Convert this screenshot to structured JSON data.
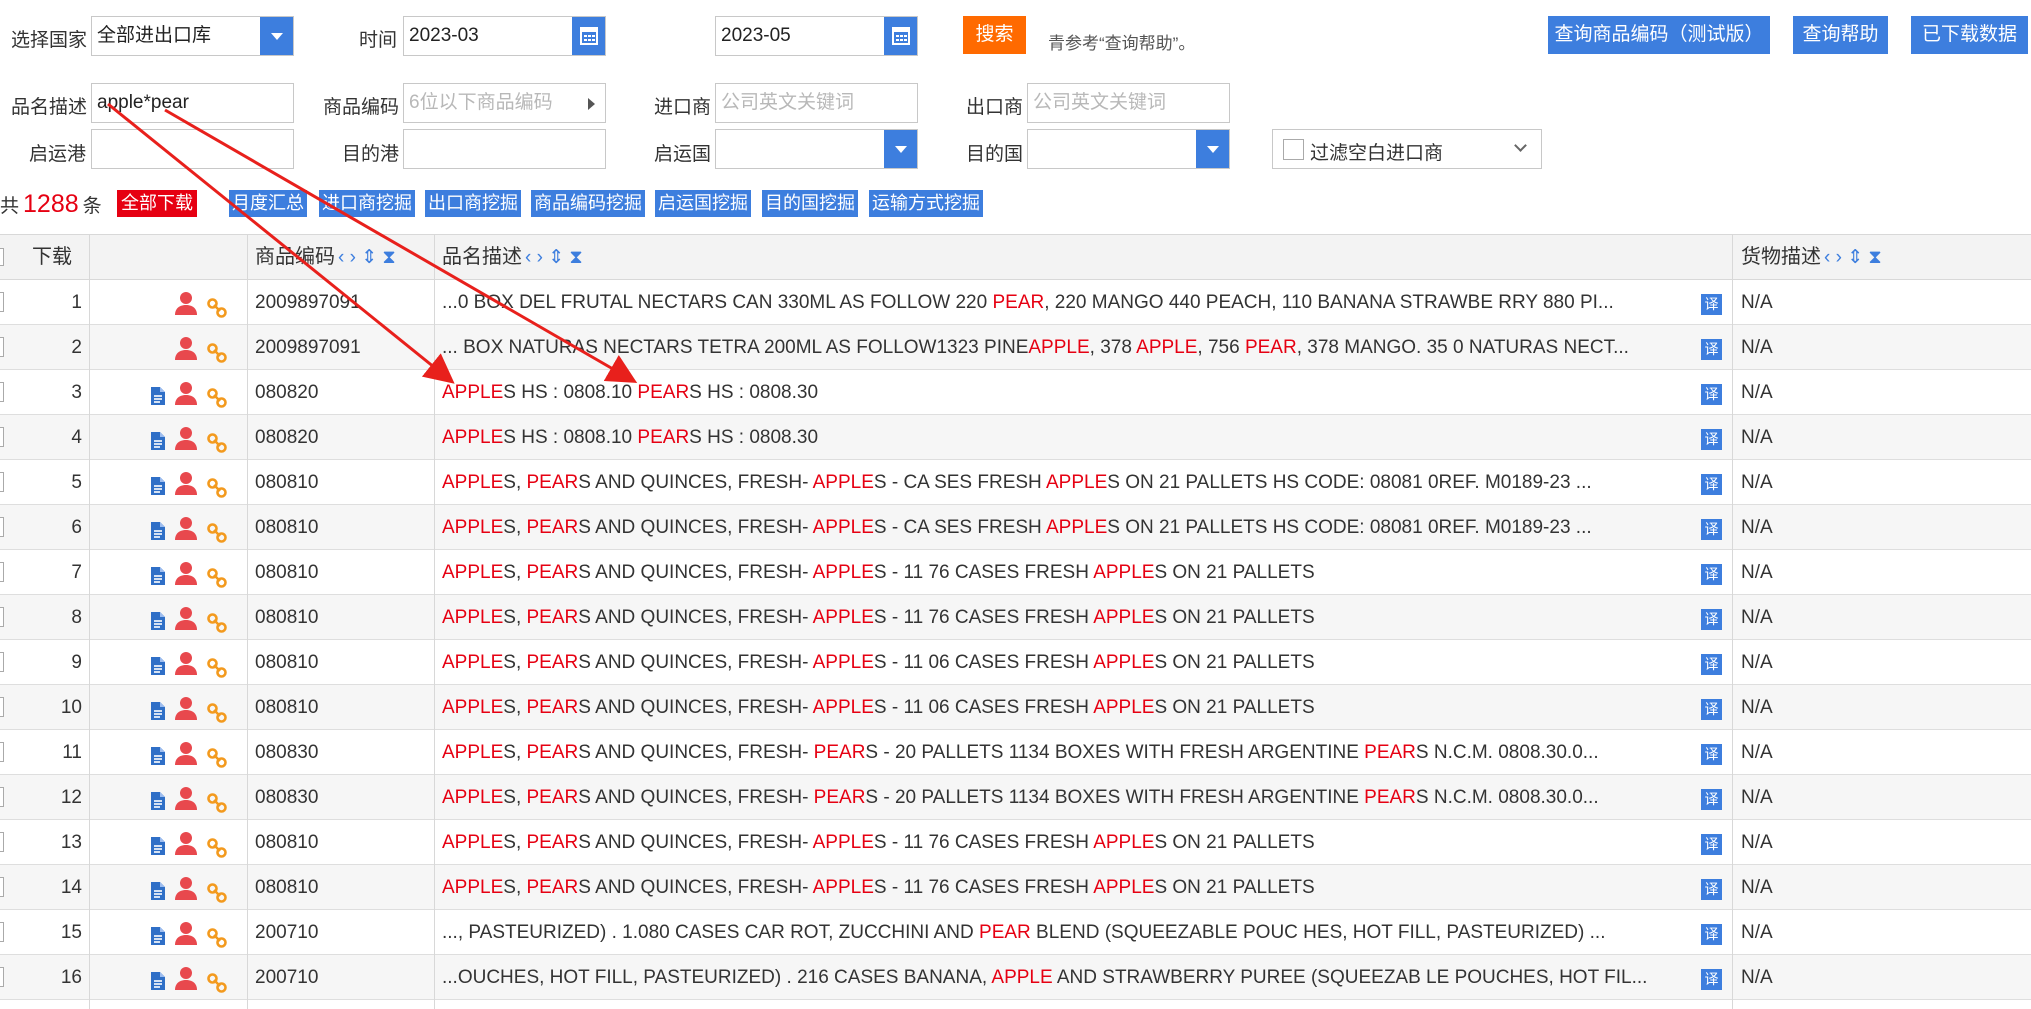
{
  "filters": {
    "country_label": "选择国家",
    "country_value": "全部进出口库",
    "time_label": "时间",
    "time_start": "2023-03",
    "time_end": "2023-05",
    "search_button": "搜索",
    "hint": "青参考“查询帮助”。",
    "product_desc_label": "品名描述",
    "product_desc_value": "apple*pear",
    "product_code_label": "商品编码",
    "product_code_placeholder": "6位以下商品编码",
    "importer_label": "进口商",
    "importer_placeholder": "公司英文关键词",
    "exporter_label": "出口商",
    "exporter_placeholder": "公司英文关键词",
    "origin_port_label": "启运港",
    "dest_port_label": "目的港",
    "origin_country_label": "启运国",
    "dest_country_label": "目的国",
    "filter_blank_importer": "过滤空白进口商"
  },
  "top_buttons": {
    "query_code": "查询商品编码（测试版）",
    "query_help": "查询帮助",
    "downloaded": "已下载数据"
  },
  "summary": {
    "prefix": "共",
    "count": "1288",
    "suffix": "条",
    "download_all": "全部下载"
  },
  "tools": [
    "月度汇总",
    "进口商挖掘",
    "出口商挖掘",
    "商品编码挖掘",
    "启运国挖掘",
    "目的国挖掘",
    "运输方式挖掘"
  ],
  "table": {
    "headers": {
      "download": "下载",
      "code": "商品编码",
      "desc": "品名描述",
      "goods": "货物描述"
    },
    "sort_icons": "‹ › ⇕ ⧗",
    "translate_icon": "译",
    "rows": [
      {
        "idx": "1",
        "doc": false,
        "code": "2009897091",
        "desc": "...0 BOX DEL FRUTAL NECTARS CAN 330ML AS FOLLOW 220 <b>PEAR</b>, 220 MANGO 440 PEACH, 110 BANANA STRAWBE RRY 880 PI...",
        "goods": "N/A"
      },
      {
        "idx": "2",
        "doc": false,
        "code": "2009897091",
        "desc": "... BOX NATURAS NECTARS TETRA 200ML AS FOLLOW1323 PINE<b>APPLE</b>, 378 <b>APPLE</b>, 756 <b>PEAR</b>, 378 MANGO. 35 0 NATURAS NECT...",
        "goods": "N/A"
      },
      {
        "idx": "3",
        "doc": true,
        "code": "080820",
        "desc": "<b>APPLE</b>S HS : 0808.10 <b>PEAR</b>S HS : 0808.30",
        "goods": "N/A"
      },
      {
        "idx": "4",
        "doc": true,
        "code": "080820",
        "desc": "<b>APPLE</b>S HS : 0808.10 <b>PEAR</b>S HS : 0808.30",
        "goods": "N/A"
      },
      {
        "idx": "5",
        "doc": true,
        "code": "080810",
        "desc": "<b>APPLE</b>S, <b>PEAR</b>S AND QUINCES, FRESH- <b>APPLE</b>S - CA SES FRESH <b>APPLE</b>S ON 21 PALLETS HS CODE: 08081 0REF. M0189-23 ...",
        "goods": "N/A"
      },
      {
        "idx": "6",
        "doc": true,
        "code": "080810",
        "desc": "<b>APPLE</b>S, <b>PEAR</b>S AND QUINCES, FRESH- <b>APPLE</b>S - CA SES FRESH <b>APPLE</b>S ON 21 PALLETS HS CODE: 08081 0REF. M0189-23 ...",
        "goods": "N/A"
      },
      {
        "idx": "7",
        "doc": true,
        "code": "080810",
        "desc": "<b>APPLE</b>S, <b>PEAR</b>S AND QUINCES, FRESH- <b>APPLE</b>S - 11 76 CASES FRESH <b>APPLE</b>S ON 21 PALLETS",
        "goods": "N/A"
      },
      {
        "idx": "8",
        "doc": true,
        "code": "080810",
        "desc": "<b>APPLE</b>S, <b>PEAR</b>S AND QUINCES, FRESH- <b>APPLE</b>S - 11 76 CASES FRESH <b>APPLE</b>S ON 21 PALLETS",
        "goods": "N/A"
      },
      {
        "idx": "9",
        "doc": true,
        "code": "080810",
        "desc": "<b>APPLE</b>S, <b>PEAR</b>S AND QUINCES, FRESH- <b>APPLE</b>S - 11 06 CASES FRESH <b>APPLE</b>S ON 21 PALLETS",
        "goods": "N/A"
      },
      {
        "idx": "10",
        "doc": true,
        "code": "080810",
        "desc": "<b>APPLE</b>S, <b>PEAR</b>S AND QUINCES, FRESH- <b>APPLE</b>S - 11 06 CASES FRESH <b>APPLE</b>S ON 21 PALLETS",
        "goods": "N/A"
      },
      {
        "idx": "11",
        "doc": true,
        "code": "080830",
        "desc": "<b>APPLE</b>S, <b>PEAR</b>S AND QUINCES, FRESH- <b>PEAR</b>S - 20 PALLETS 1134 BOXES WITH FRESH ARGENTINE <b>PEAR</b>S N.C.M. 0808.30.0...",
        "goods": "N/A"
      },
      {
        "idx": "12",
        "doc": true,
        "code": "080830",
        "desc": "<b>APPLE</b>S, <b>PEAR</b>S AND QUINCES, FRESH- <b>PEAR</b>S - 20 PALLETS 1134 BOXES WITH FRESH ARGENTINE <b>PEAR</b>S N.C.M. 0808.30.0...",
        "goods": "N/A"
      },
      {
        "idx": "13",
        "doc": true,
        "code": "080810",
        "desc": "<b>APPLE</b>S, <b>PEAR</b>S AND QUINCES, FRESH- <b>APPLE</b>S - 11 76 CASES FRESH <b>APPLE</b>S ON 21 PALLETS",
        "goods": "N/A"
      },
      {
        "idx": "14",
        "doc": true,
        "code": "080810",
        "desc": "<b>APPLE</b>S, <b>PEAR</b>S AND QUINCES, FRESH- <b>APPLE</b>S - 11 76 CASES FRESH <b>APPLE</b>S ON 21 PALLETS",
        "goods": "N/A"
      },
      {
        "idx": "15",
        "doc": true,
        "code": "200710",
        "desc": "..., PASTEURIZED) . 1.080 CASES CAR ROT, ZUCCHINI AND <b>PEAR</b> BLEND (SQUEEZABLE POUC HES, HOT FILL, PASTEURIZED) ...",
        "goods": "N/A"
      },
      {
        "idx": "16",
        "doc": true,
        "code": "200710",
        "desc": "...OUCHES, HOT FILL, PASTEURIZED) . 216 CASES BANANA, <b>APPLE</b> AND STRAWBERRY PUREE (SQUEEZAB LE POUCHES, HOT FIL...",
        "goods": "N/A"
      }
    ]
  },
  "colors": {
    "accent_blue": "#3d7ede",
    "search_orange": "#ff6a00",
    "highlight_red": "#e60012",
    "icon_person_red": "#e8484d",
    "icon_link_orange": "#f39a1e"
  }
}
